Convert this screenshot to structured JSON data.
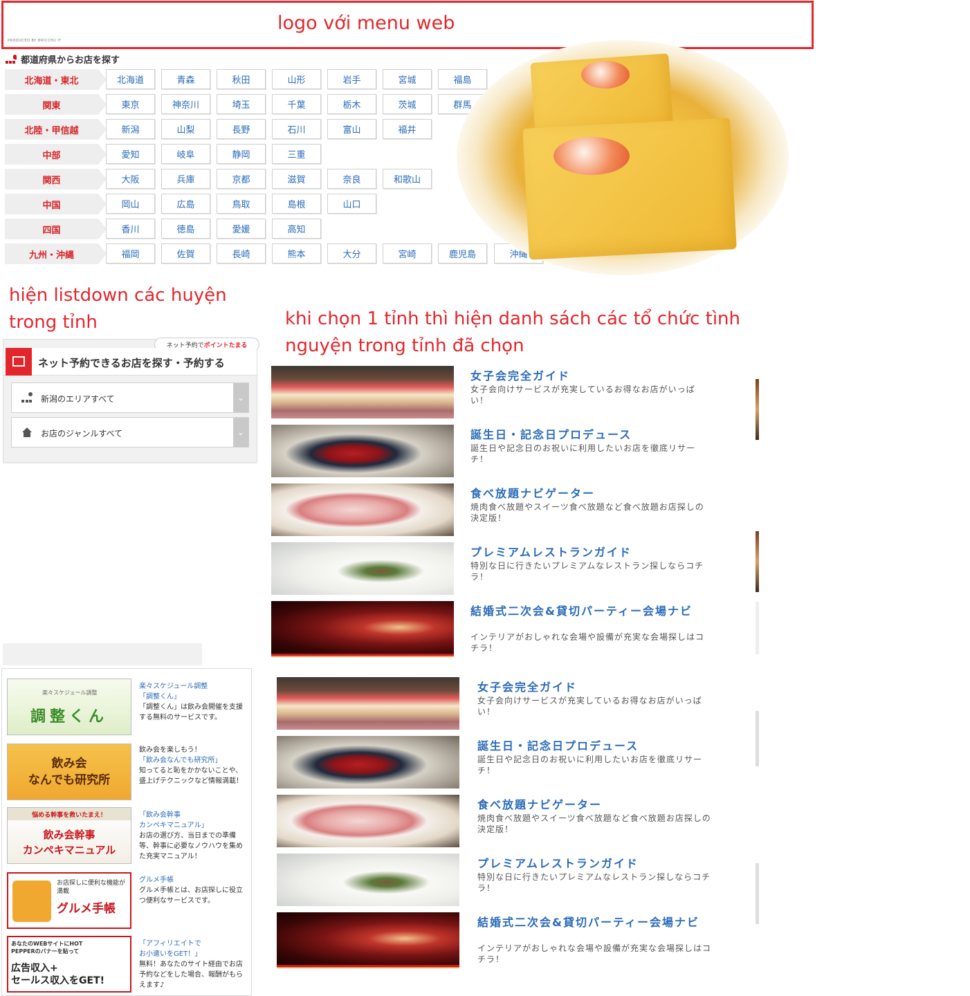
{
  "annotations": {
    "header_note": "logo với menu web",
    "district_note_line1": "hiện listdown các huyện",
    "district_note_line2": "trong tỉnh",
    "org_note_line1": "khi chọn 1 tỉnh thì hiện danh sách các tổ chức tình",
    "org_note_line2": "nguyện trong tỉnh đã chọn"
  },
  "header": {
    "produced_by": "PRODUCED BY BRICCHU IT"
  },
  "prefecture_search": {
    "title": "都道府県からお店を探す",
    "regions": [
      {
        "label": "北海道・東北",
        "prefectures": [
          "北海道",
          "青森",
          "秋田",
          "山形",
          "岩手",
          "宮城",
          "福島"
        ]
      },
      {
        "label": "関東",
        "prefectures": [
          "東京",
          "神奈川",
          "埼玉",
          "千葉",
          "栃木",
          "茨城",
          "群馬"
        ]
      },
      {
        "label": "北陸・甲信越",
        "prefectures": [
          "新潟",
          "山梨",
          "長野",
          "石川",
          "富山",
          "福井"
        ]
      },
      {
        "label": "中部",
        "prefectures": [
          "愛知",
          "岐阜",
          "静岡",
          "三重"
        ]
      },
      {
        "label": "関西",
        "prefectures": [
          "大阪",
          "兵庫",
          "京都",
          "滋賀",
          "奈良",
          "和歌山"
        ]
      },
      {
        "label": "中国",
        "prefectures": [
          "岡山",
          "広島",
          "鳥取",
          "島根",
          "山口"
        ]
      },
      {
        "label": "四国",
        "prefectures": [
          "香川",
          "徳島",
          "愛媛",
          "高知"
        ]
      },
      {
        "label": "九州・沖縄",
        "prefectures": [
          "福岡",
          "佐賀",
          "長崎",
          "熊本",
          "大分",
          "宮崎",
          "鹿児島",
          "沖縄"
        ]
      }
    ]
  },
  "search_widget": {
    "badge_prefix": "ネット予約で",
    "badge_highlight": "ポイントたまる",
    "title": "ネット予約できるお店を探す・予約する",
    "area_select": "新潟のエリアすべて",
    "genre_select": "お店のジャンルすべて",
    "accent_color": "#e3262c"
  },
  "side_banners": [
    {
      "image_text": "調整くん",
      "image_top": "楽々スケジュール調整",
      "title": "楽々スケジュール調整",
      "link": "「調整くん」",
      "desc": "「調整くん」は飲み会開催を支援する無料のサービスです。"
    },
    {
      "image_text": "飲み会\nなんでも研究所",
      "title": "飲み会を楽しもう！",
      "link": "「飲み会なんでも研究所」",
      "desc": "知ってると恥をかかないことや、盛上げテクニックなど情報満載！"
    },
    {
      "image_text": "飲み会幹事\nカンペキマニュアル",
      "image_top": "悩める幹事を救いたまえ！",
      "title": "「飲み会幹事",
      "link": "カンペキマニュアル」",
      "desc": "お店の選び方、当日までの準備等、幹事に必要なノウハウを集めた充実マニュアル！"
    },
    {
      "image_text": "グルメ手帳",
      "image_top": "お店探しに便利な機能が満載",
      "title": "グルメ手帳",
      "link": "",
      "desc": "グルメ手帳とは、お店探しに役立つ便利なサービスです。"
    },
    {
      "image_text": "広告収入+\nセールス収入をGET!",
      "image_top": "あなたのWEBサイトにHOT PEPPERのバナーを貼って",
      "title": "「アフィリエイトで",
      "link": "お小遣いをGET！」",
      "desc": "無料！あなたのサイト経由でお店予約などをした場合、報酬がもらえます♪"
    }
  ],
  "features": [
    {
      "title": "女子会完全ガイド",
      "desc": "女子会向けサービスが充実しているお得なお店がいっぱい！"
    },
    {
      "title": "誕生日・記念日プロデュース",
      "desc": "誕生日や記念日のお祝いに利用したいお店を徹底リサーチ！"
    },
    {
      "title": "食べ放題ナビゲーター",
      "desc": "焼肉食べ放題やスイーツ食べ放題など食べ放題お店探しの決定版！"
    },
    {
      "title": "プレミアムレストランガイド",
      "desc": "特別な日に行きたいプレミアムなレストラン探しならコチラ！"
    },
    {
      "title": "結婚式二次会&貸切パーティー会場ナビ",
      "desc": "インテリアがおしゃれな会場や設備が充実な会場探しはコチラ！"
    }
  ],
  "features_repeat": [
    {
      "title": "女子会完全ガイド",
      "desc": "女子会向けサービスが充実しているお得なお店がいっぱい！"
    },
    {
      "title": "誕生日・記念日プロデュース",
      "desc": "誕生日や記念日のお祝いに利用したいお店を徹底リサーチ！"
    },
    {
      "title": "食べ放題ナビゲーター",
      "desc": "焼肉食べ放題やスイーツ食べ放題など食べ放題お店探しの決定版！"
    },
    {
      "title": "プレミアムレストランガイド",
      "desc": "特別な日に行きたいプレミアムなレストラン探しならコチラ！"
    },
    {
      "title": "結婚式二次会&貸切パーティー会場ナビ",
      "desc": "インテリアがおしゃれな会場や設備が充実な会場探しはコチラ！"
    }
  ],
  "colors": {
    "annotation_red": "#e3262c",
    "link_blue": "#2a6bb8",
    "region_red": "#d6262c"
  }
}
